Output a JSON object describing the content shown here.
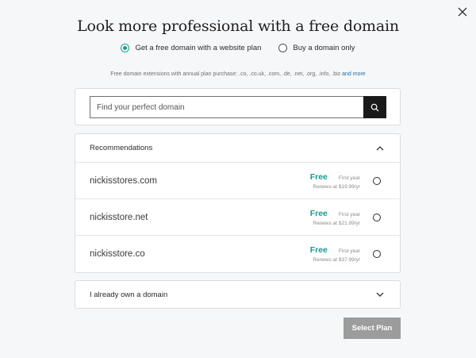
{
  "dialog": {
    "title": "Look more professional with a free domain",
    "close_icon": "close-icon"
  },
  "mode_options": [
    {
      "label": "Get a free domain with a website plan",
      "selected": true
    },
    {
      "label": "Buy a domain only",
      "selected": false
    }
  ],
  "extensions": {
    "text": "Free domain extensions with annual plan purchase: .co, .co.uk, .com, .de, .net, .org, .info, .biz",
    "link": "and more"
  },
  "search": {
    "placeholder": "Find your perfect domain",
    "value": "",
    "button_icon": "search-icon"
  },
  "recommendations": {
    "header": "Recommendations",
    "expanded": true,
    "items": [
      {
        "domain": "nickisstores.com",
        "price": "Free",
        "term": "First year",
        "renews": "Renews at $19.99/yr"
      },
      {
        "domain": "nickisstore.net",
        "price": "Free",
        "term": "First year",
        "renews": "Renews at $21.99/yr"
      },
      {
        "domain": "nickisstore.co",
        "price": "Free",
        "term": "First year",
        "renews": "Renews at $37.99/yr"
      }
    ]
  },
  "own_domain": {
    "label": "I already own a domain",
    "expanded": false
  },
  "actions": {
    "select_plan": "Select Plan"
  },
  "colors": {
    "accent": "#1a9b8f",
    "link": "#1a6fb5",
    "button_disabled": "#9c9c9c",
    "search_button": "#1a1a1a"
  }
}
